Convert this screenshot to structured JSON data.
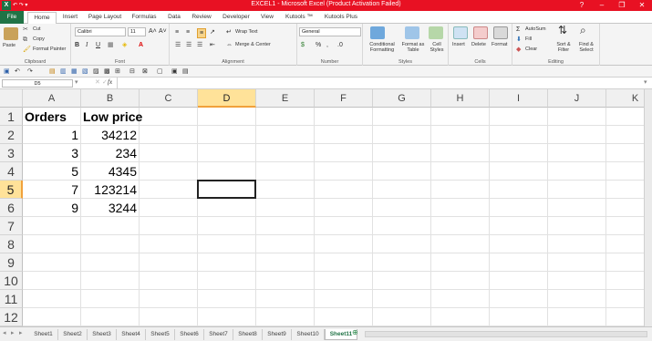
{
  "window": {
    "title": "EXCEL1 - Microsoft Excel (Product Activation Failed)",
    "app_icon": "X",
    "controls": [
      "?",
      "–",
      "❐",
      "✕"
    ]
  },
  "ribbon_tabs": [
    "File",
    "Home",
    "Insert",
    "Page Layout",
    "Formulas",
    "Data",
    "Review",
    "Developer",
    "View",
    "Kutools ™",
    "Kutools Plus"
  ],
  "ribbon": {
    "clipboard": {
      "paste": "Paste",
      "cut": "Cut",
      "copy": "Copy",
      "format_painter": "Format Painter",
      "label": "Clipboard"
    },
    "font": {
      "name": "Calibri",
      "size": "11",
      "bold": "B",
      "italic": "I",
      "underline": "U",
      "label": "Font"
    },
    "alignment": {
      "wrap": "Wrap Text",
      "merge": "Merge & Center",
      "label": "Alignment"
    },
    "number": {
      "format": "General",
      "percent": "%",
      "comma": ",",
      "label": "Number"
    },
    "styles": {
      "cond": "Conditional Formatting",
      "format_table": "Format as Table",
      "cell_styles": "Cell Styles",
      "label": "Styles"
    },
    "cells": {
      "insert": "Insert",
      "delete": "Delete",
      "format": "Format",
      "label": "Cells"
    },
    "editing": {
      "autosum": "AutoSum",
      "fill": "Fill",
      "clear": "Clear",
      "sort": "Sort & Filter",
      "find": "Find & Select",
      "label": "Editing"
    }
  },
  "formula_bar": {
    "name_box": "D5",
    "fx": "fx",
    "value": ""
  },
  "columns": [
    "A",
    "B",
    "C",
    "D",
    "E",
    "F",
    "G",
    "H",
    "I",
    "J",
    "K"
  ],
  "rows": [
    "1",
    "2",
    "3",
    "4",
    "5",
    "6",
    "7",
    "8",
    "9",
    "10",
    "11",
    "12"
  ],
  "selected": {
    "column": "D",
    "row": "5"
  },
  "cells": {
    "A1": "Orders",
    "B1": "Low price",
    "A2": "1",
    "B2": "34212",
    "A3": "3",
    "B3": "234",
    "A4": "5",
    "B4": "4345",
    "A5": "7",
    "B5": "123214",
    "A6": "9",
    "B6": "3244"
  },
  "sheets": [
    "Sheet1",
    "Sheet2",
    "Sheet3",
    "Sheet4",
    "Sheet5",
    "Sheet6",
    "Sheet7",
    "Sheet8",
    "Sheet9",
    "Sheet10",
    "Sheet11"
  ],
  "active_sheet": "Sheet11",
  "colors": {
    "title_bar": "#e81123",
    "file_tab": "#217346",
    "selection": "#ffe299"
  }
}
